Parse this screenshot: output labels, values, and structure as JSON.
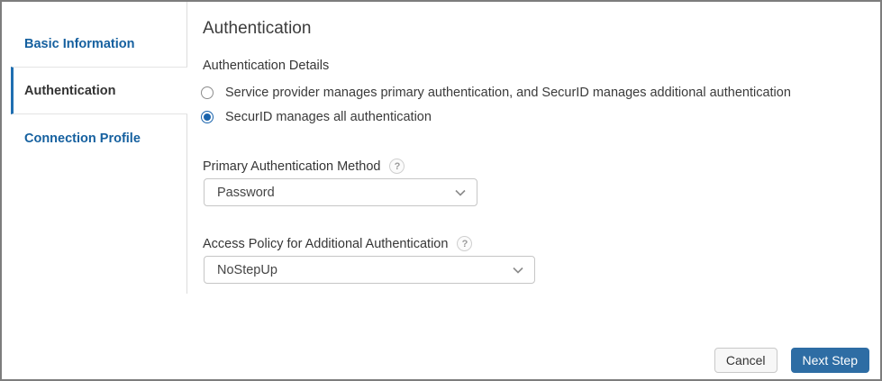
{
  "sidebar": {
    "items": [
      {
        "label": "Basic Information",
        "active": false
      },
      {
        "label": "Authentication",
        "active": true
      },
      {
        "label": "Connection Profile",
        "active": false
      }
    ]
  },
  "main": {
    "heading": "Authentication",
    "auth_details": {
      "label": "Authentication Details",
      "options": [
        {
          "label": "Service provider manages primary authentication, and SecurID manages additional authentication",
          "selected": false
        },
        {
          "label": "SecurID manages all authentication",
          "selected": true
        }
      ]
    },
    "primary_auth": {
      "label": "Primary Authentication Method",
      "help_icon": "?",
      "value": "Password"
    },
    "access_policy": {
      "label": "Access Policy for Additional Authentication",
      "help_icon": "?",
      "value": "NoStepUp"
    }
  },
  "footer": {
    "cancel_label": "Cancel",
    "next_label": "Next Step"
  },
  "colors": {
    "link_blue": "#15609f",
    "active_bar_blue": "#1f6fb2",
    "radio_selected_blue": "#1a64ad",
    "primary_button_blue": "#2e6da4",
    "outer_border_gray": "#7d7d7d"
  }
}
